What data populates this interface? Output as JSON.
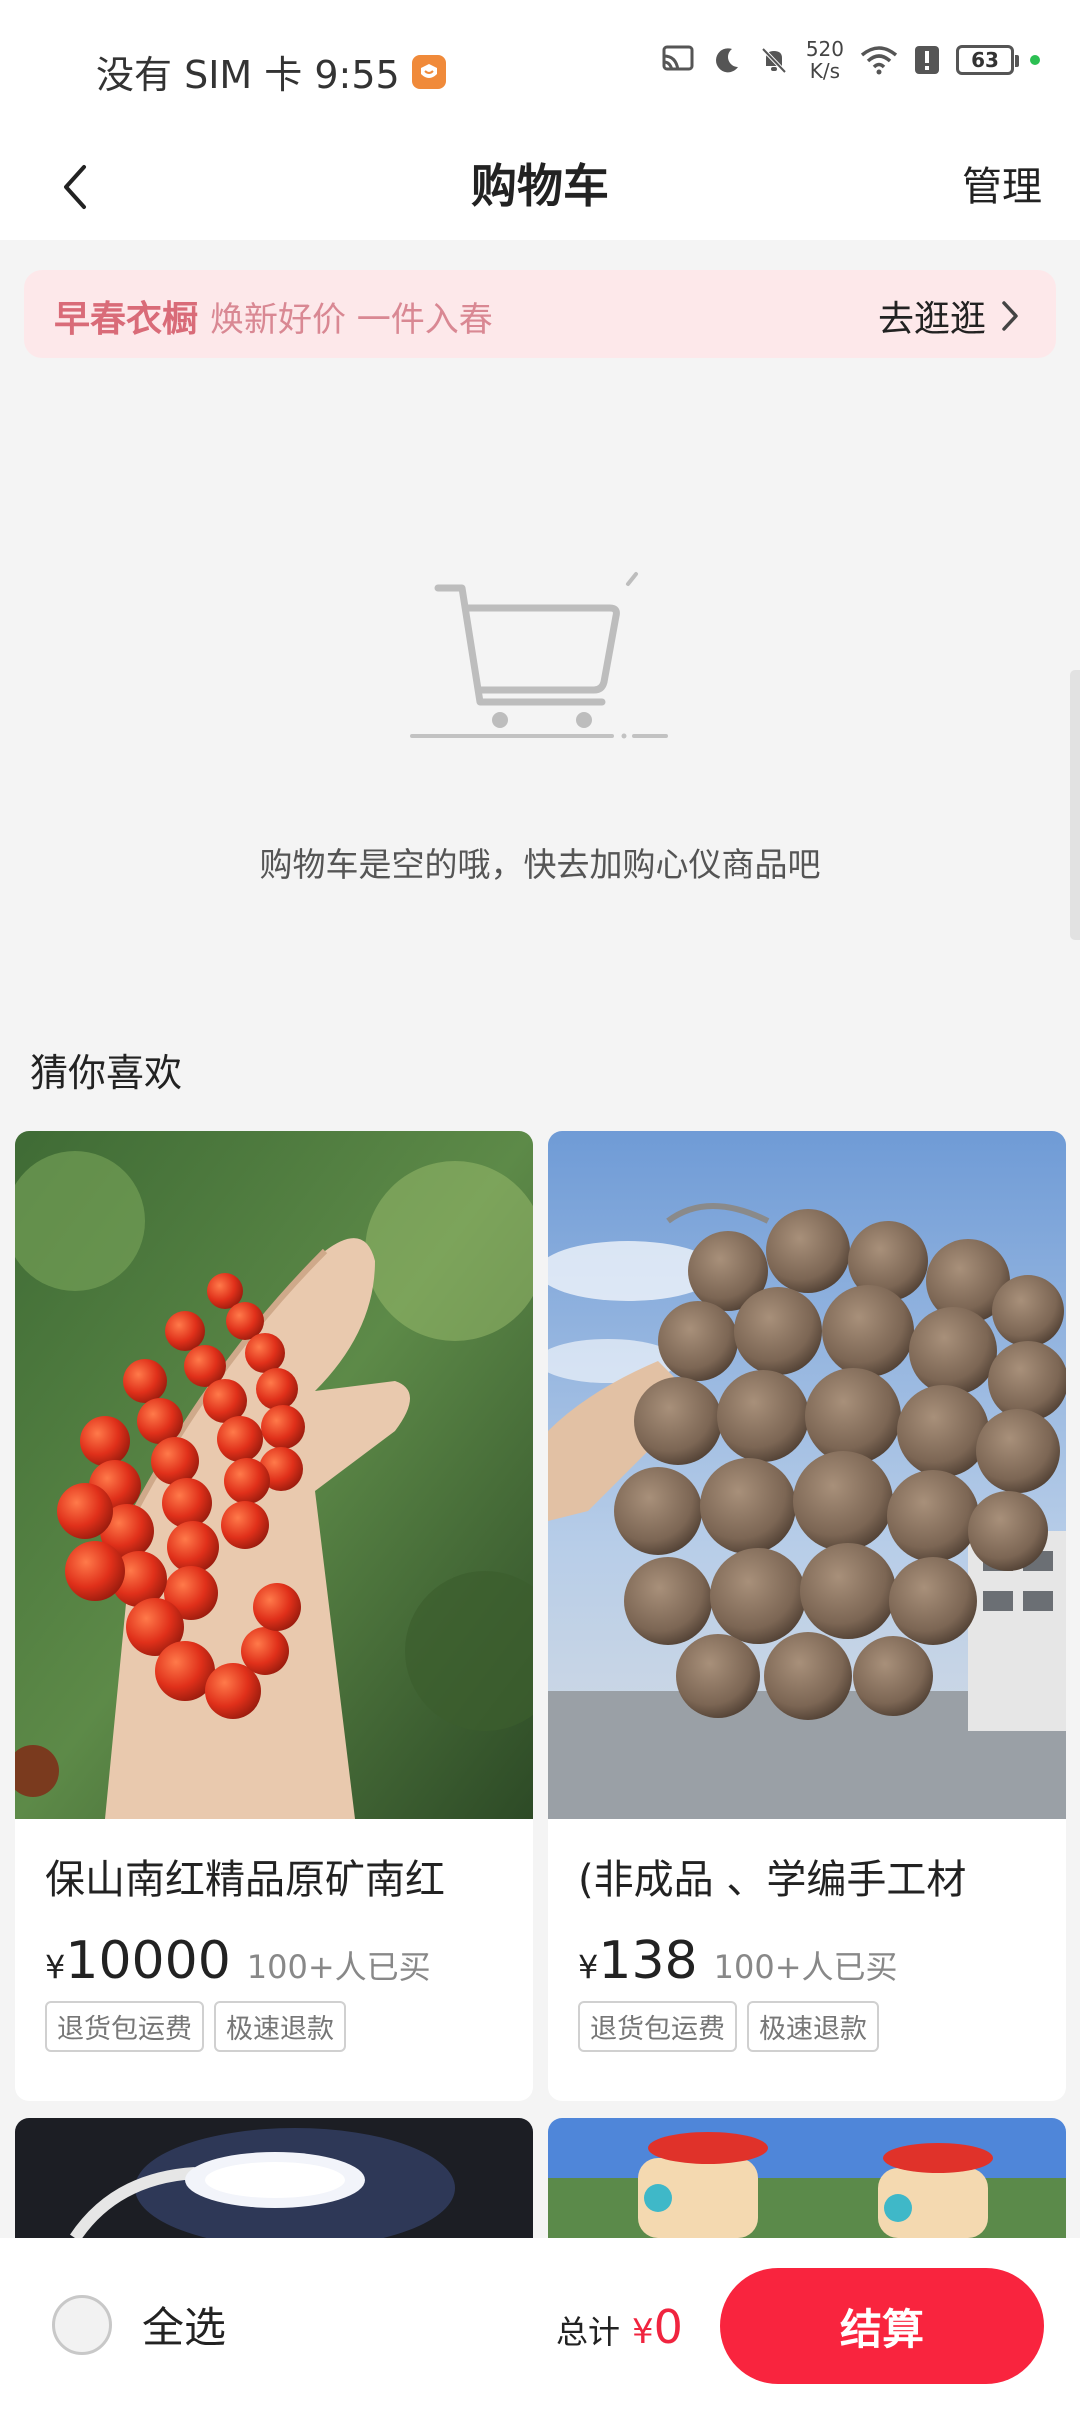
{
  "status_bar": {
    "carrier_time": "没有 SIM 卡 9:55",
    "net_speed_value": "520",
    "net_speed_unit": "K/s",
    "battery": "63"
  },
  "header": {
    "title": "购物车",
    "manage_label": "管理"
  },
  "promo": {
    "title": "早春衣橱",
    "subtitle": "焕新好价 一件入春",
    "cta": "去逛逛"
  },
  "empty_cart": {
    "message": "购物车是空的哦，快去加购心仪商品吧"
  },
  "recommend": {
    "heading": "猜你喜欢",
    "products": [
      {
        "title": "保山南红精品原矿南红",
        "currency": "¥",
        "price": "10000",
        "sold": "100+人已买",
        "tags": [
          "退货包运费",
          "极速退款"
        ]
      },
      {
        "title": "(非成品 、学编手工材",
        "currency": "¥",
        "price": "138",
        "sold": "100+人已买",
        "tags": [
          "退货包运费",
          "极速退款"
        ]
      }
    ]
  },
  "bottom_bar": {
    "select_all_label": "全选",
    "total_label": "总计",
    "total_currency": "¥",
    "total_amount": "0",
    "checkout_label": "结算"
  },
  "colors": {
    "accent": "#f9243e",
    "promo_bg": "#fde8ea",
    "promo_text": "#d96b78"
  }
}
